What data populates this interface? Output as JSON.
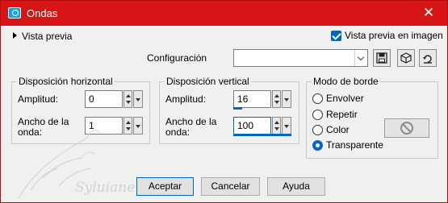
{
  "window": {
    "title": "Ondas",
    "close_glyph": "✕"
  },
  "preview": {
    "toggle_label": "Vista previa",
    "checkbox_label": "Vista previa en imagen",
    "checked": true
  },
  "config": {
    "label": "Configuración",
    "value": ""
  },
  "horizontal": {
    "legend": "Disposición horizontal",
    "amplitude_label": "Amplitud:",
    "amplitude_value": "0",
    "wavelength_label_1": "Ancho de la",
    "wavelength_label_2": "onda:",
    "wavelength_value": "1"
  },
  "vertical": {
    "legend": "Disposición vertical",
    "amplitude_label": "Amplitud:",
    "amplitude_value": "16",
    "wavelength_label_1": "Ancho de la",
    "wavelength_label_2": "onda:",
    "wavelength_value": "100"
  },
  "edge_mode": {
    "legend": "Modo de borde",
    "options": [
      "Envolver",
      "Repetir",
      "Color",
      "Transparente"
    ],
    "selected": "Transparente"
  },
  "buttons": {
    "ok": "Aceptar",
    "cancel": "Cancelar",
    "help": "Ayuda"
  },
  "watermark_text": "Syluiane",
  "colors": {
    "titlebar": "#d71416",
    "accent": "#0067c0",
    "dialog_bg": "#f0f0f0"
  }
}
